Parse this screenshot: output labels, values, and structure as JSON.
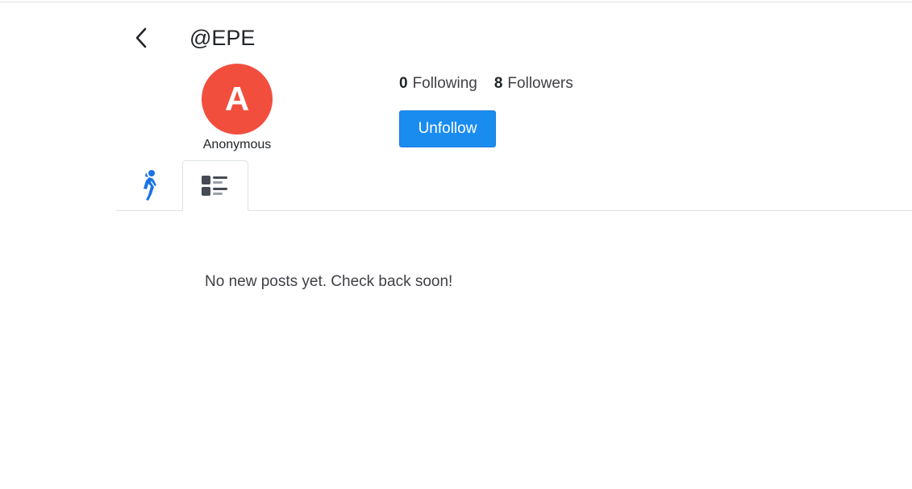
{
  "header": {
    "back_icon": "chevron-left-icon",
    "handle": "@EPE"
  },
  "profile": {
    "avatar_letter": "A",
    "avatar_color": "#f24e3e",
    "display_name": "Anonymous"
  },
  "stats": {
    "following_count": "0",
    "following_label": "Following",
    "followers_count": "8",
    "followers_label": "Followers"
  },
  "actions": {
    "unfollow_label": "Unfollow",
    "accent_color": "#1a8cf0"
  },
  "tabs": [
    {
      "icon": "activity-runner-icon",
      "active": false
    },
    {
      "icon": "posts-list-icon",
      "active": true
    }
  ],
  "content": {
    "empty_message": "No new posts yet. Check back soon!"
  }
}
